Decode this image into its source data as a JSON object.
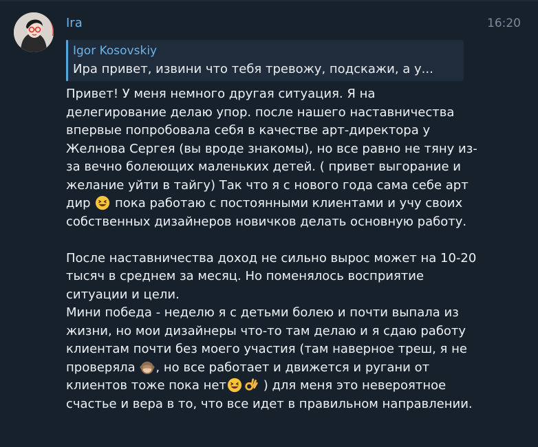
{
  "chat": {
    "sender_name": "Ira",
    "time": "16:20",
    "avatar_icon": "user-avatar",
    "reply": {
      "author": "Igor Kosovskiy",
      "text": "Ира привет, извини что тебя тревожу, подскажи, а у..."
    },
    "message": {
      "p1_a": "Привет! У меня немного другая ситуация. Я на делегирование делаю упор. после нашего наставничества впервые попробовала себя в качестве арт-директора у Желнова Сергея (вы вроде знакомы), но все равно не тяну из-за вечно болеющих маленьких детей. ( привет выгорание и желание уйти в тайгу) Так что я с нового года сама себе арт дир",
      "emoji_1": "laughing-emoji",
      "p1_b": " пока работаю с постоянными клиентами и учу своих собственных дизайнеров новичков делать основную работу.",
      "p2": "После наставничества доход не сильно вырос может на 10-20 тысяч в среднем за месяц. Но поменялось восприятие ситуации и цели.",
      "p3_a": "Мини победа - неделю я с детьми болею и почти выпала из жизни, но мои дизайнеры что-то там делаю и я сдаю работу клиентам почти без моего участия (там наверное треш, я не проверяла",
      "emoji_2": "see-no-evil-monkey-emoji",
      "p3_b": ", но все работает и движется и ругани от клиентов тоже пока нет",
      "emoji_3": "laughing-emoji",
      "emoji_4": "ok-hand-emoji",
      "p3_c": " ) для меня это невероятное счастье и вера в то, что все идет в правильном направлении."
    }
  }
}
